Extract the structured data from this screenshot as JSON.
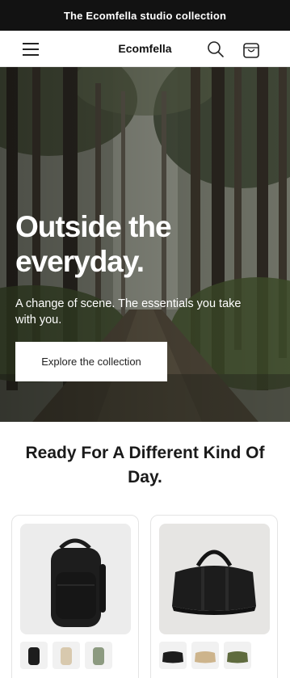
{
  "announcement": {
    "text": "The Ecomfella studio collection"
  },
  "header": {
    "brand": "Ecomfella",
    "icons": [
      "hamburger-menu-icon",
      "search-icon",
      "cart-icon"
    ]
  },
  "hero": {
    "title": "Outside the everyday.",
    "subtitle": "A change of scene. The essentials you take with you.",
    "cta_label": "Explore the collection"
  },
  "featured": {
    "title": "Ready For A Different Kind Of Day.",
    "products": [
      {
        "image": "black-backpack",
        "swatches": [
          "black",
          "beige",
          "sage-green"
        ]
      },
      {
        "image": "black-duffel-bag",
        "swatches": [
          "black",
          "tan",
          "olive"
        ]
      }
    ]
  },
  "colors": {
    "announcement_bg": "#121212",
    "hero_text": "#ffffff",
    "cta_bg": "#ffffff"
  }
}
